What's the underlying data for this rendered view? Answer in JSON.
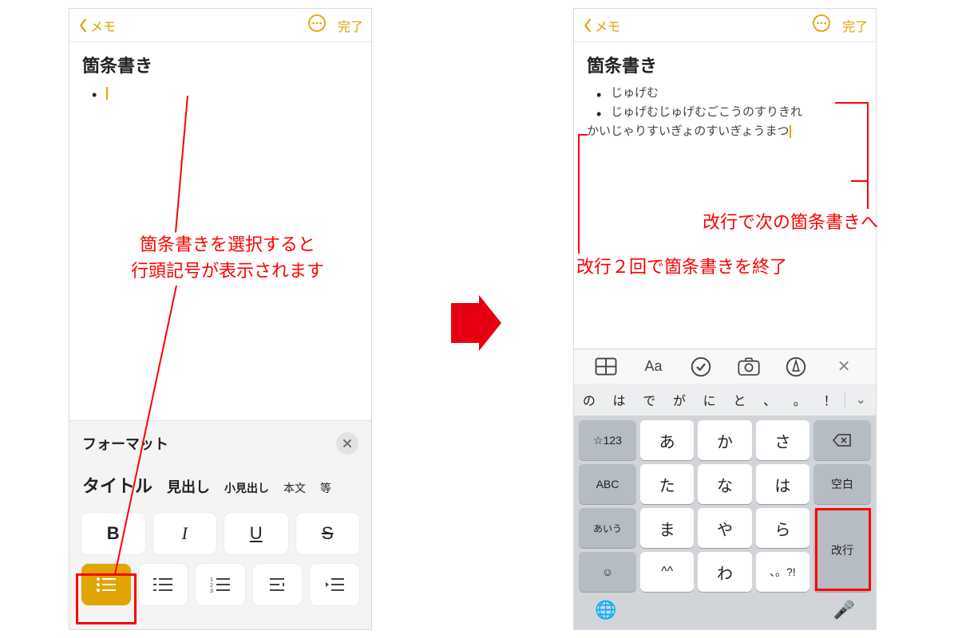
{
  "nav": {
    "back_label": "メモ",
    "done_label": "完了"
  },
  "left": {
    "note_title": "箇条書き",
    "format_label": "フォーマット",
    "styles": {
      "title": "タイトル",
      "heading": "見出し",
      "subheading": "小見出し",
      "body": "本文",
      "etc": "等"
    },
    "bius": {
      "b": "B",
      "i": "I",
      "u": "U",
      "s": "S"
    }
  },
  "right": {
    "note_title": "箇条書き",
    "bullet1": "じゅげむ",
    "bullet2": "じゅげむじゅげむごこうのすりきれ",
    "wrap": "かいじゃりすいぎょのすいぎょうまつ",
    "toolbar_aa": "Aa",
    "suggestions": [
      "の",
      "は",
      "で",
      "が",
      "に",
      "と",
      "、",
      "。",
      "！"
    ],
    "keys": {
      "star123": "☆123",
      "abc": "ABC",
      "aiu": "あいう",
      "a": "あ",
      "ka": "か",
      "sa": "さ",
      "ta": "た",
      "na": "な",
      "ha": "は",
      "ma": "ま",
      "ya": "や",
      "ra": "ら",
      "vv": "^^",
      "wa": "わ",
      "punc": "、。?!",
      "space": "空白",
      "enter": "改行"
    }
  },
  "annotations": {
    "left_text": "箇条書きを選択すると\n行頭記号が表示されます",
    "right_top": "改行で次の箇条書きへ",
    "right_bottom": "改行２回で箇条書きを終了"
  }
}
